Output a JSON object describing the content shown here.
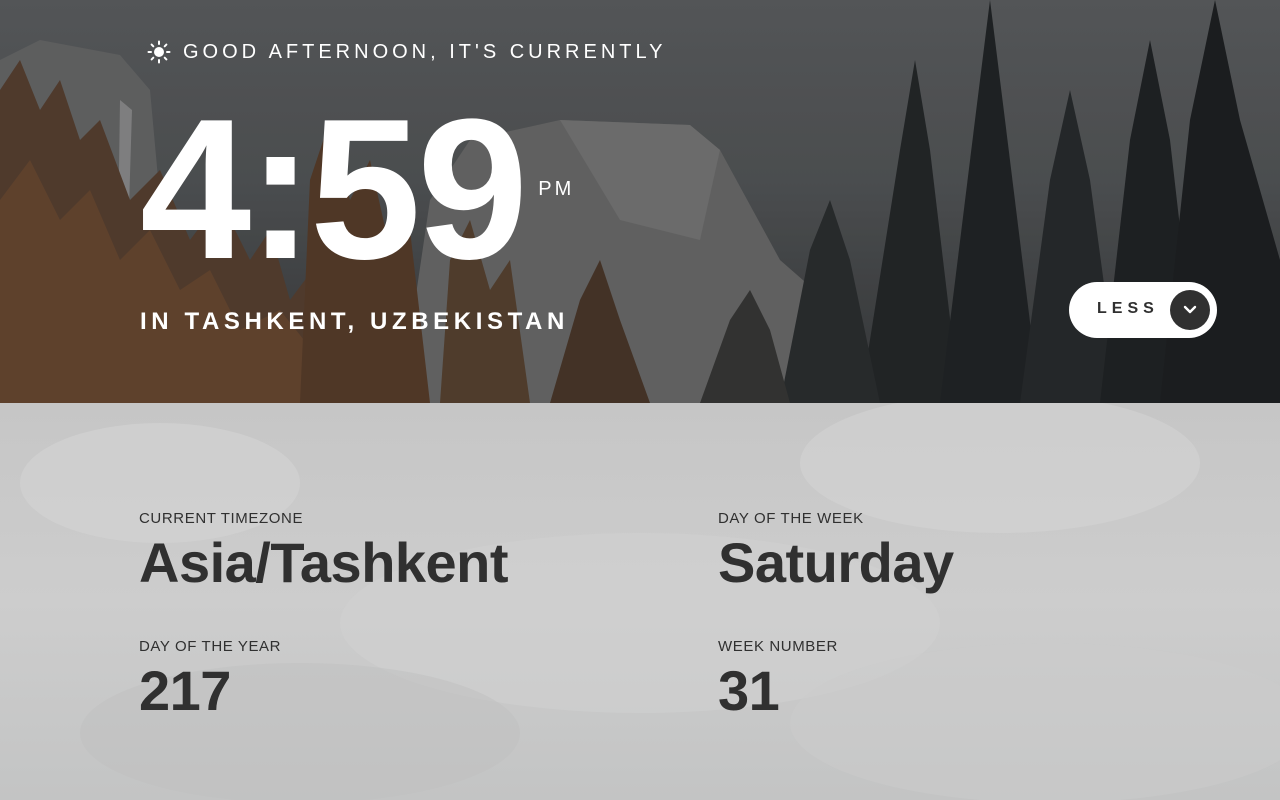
{
  "greeting": {
    "text": "GOOD AFTERNOON, IT'S CURRENTLY",
    "icon": "sun-icon"
  },
  "clock": {
    "time": "4:59",
    "period": "PM"
  },
  "location": "IN TASHKENT, UZBEKISTAN",
  "toggle": {
    "label": "LESS",
    "icon": "chevron-down-icon"
  },
  "details": {
    "timezone": {
      "label": "CURRENT TIMEZONE",
      "value": "Asia/Tashkent"
    },
    "day_of_week": {
      "label": "DAY OF THE WEEK",
      "value": "Saturday"
    },
    "day_of_year": {
      "label": "DAY OF THE YEAR",
      "value": "217"
    },
    "week_number": {
      "label": "WEEK NUMBER",
      "value": "31"
    }
  },
  "colors": {
    "text_light": "#ffffff",
    "text_dark": "#303030",
    "panel_bg": "#c9c9c9",
    "button_bg": "#ffffff",
    "chevron_bg": "#303030"
  }
}
